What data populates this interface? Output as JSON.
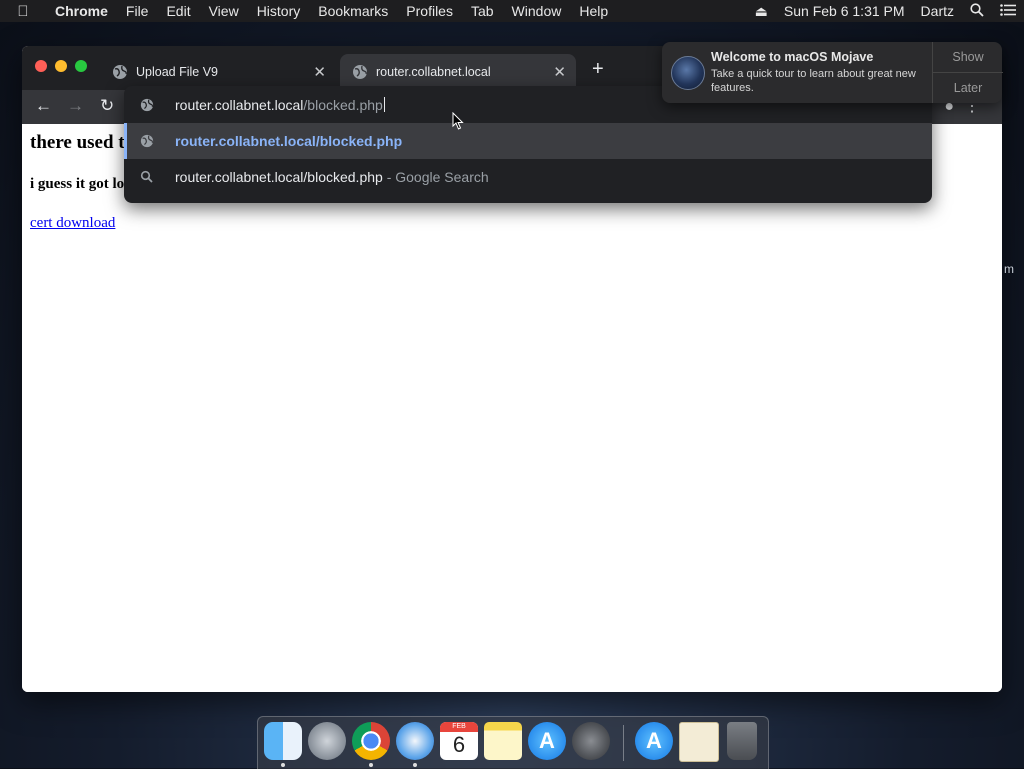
{
  "menubar": {
    "app": "Chrome",
    "menus": [
      "File",
      "Edit",
      "View",
      "History",
      "Bookmarks",
      "Profiles",
      "Tab",
      "Window",
      "Help"
    ],
    "datetime": "Sun Feb 6  1:31 PM",
    "user": "Dartz"
  },
  "tabs": [
    {
      "title": "Upload File V9"
    },
    {
      "title": "router.collabnet.local"
    }
  ],
  "omnibox": {
    "typed": "router.collabnet.local",
    "completion": "/blocked.php",
    "suggestions": [
      {
        "text": "router.collabnet.local/blocked.php",
        "icon": "globe-icon"
      },
      {
        "text": "router.collabnet.local/blocked.php",
        "suffix": "- Google Search",
        "icon": "search-icon"
      }
    ]
  },
  "page": {
    "heading": "there used t",
    "subheading": "i guess it got lo",
    "link": "cert download"
  },
  "notification": {
    "title": "Welcome to macOS Mojave",
    "body": "Take a quick tour to learn about great new features.",
    "show_label": "Show",
    "later_label": "Later"
  },
  "dock": {
    "calendar_month": "FEB",
    "calendar_day": "6",
    "items": [
      "finder-icon",
      "launchpad-icon",
      "chrome-icon",
      "safari-icon",
      "calendar-icon",
      "notes-icon",
      "app-store-icon",
      "system-preferences-icon",
      "app-store-icon",
      "certificate-icon",
      "trash-icon"
    ]
  },
  "edge_text": "m",
  "colors": {
    "accent_link": "#8ab4f8",
    "page_link": "#0000ee"
  }
}
